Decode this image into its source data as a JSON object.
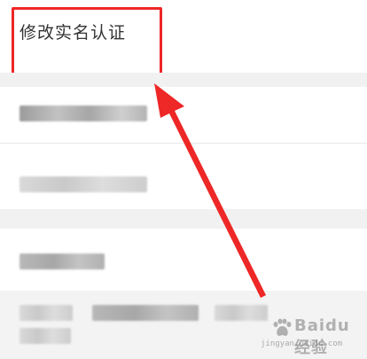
{
  "page": {
    "title": "修改实名认证"
  },
  "highlight": {
    "color": "#ee2727"
  },
  "rows": [
    {
      "name": "blurred-row-1"
    },
    {
      "name": "blurred-row-2"
    },
    {
      "name": "blurred-row-3"
    },
    {
      "name": "blurred-row-4"
    }
  ],
  "watermark": {
    "brand": "Baidu经验",
    "url": "jingyan.baidu.com"
  },
  "annotation": {
    "arrow_color": "#ee2727"
  }
}
